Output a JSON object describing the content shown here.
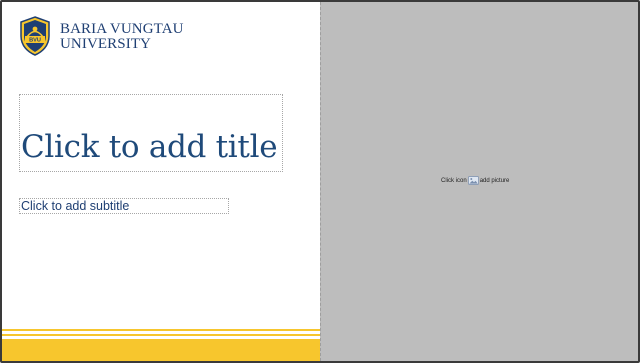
{
  "university": {
    "line1": "BARIA VUNGTAU",
    "line2": "UNIVERSITY",
    "crest_letters": "BVU"
  },
  "placeholders": {
    "title": "Click to add title",
    "subtitle": "Click to add subtitle",
    "picture_prefix": "Click icon",
    "picture_suffix": "add picture"
  },
  "colors": {
    "brand_blue": "#1f3f73",
    "accent_yellow": "#f7c62d",
    "picture_area": "#bdbdbd"
  }
}
